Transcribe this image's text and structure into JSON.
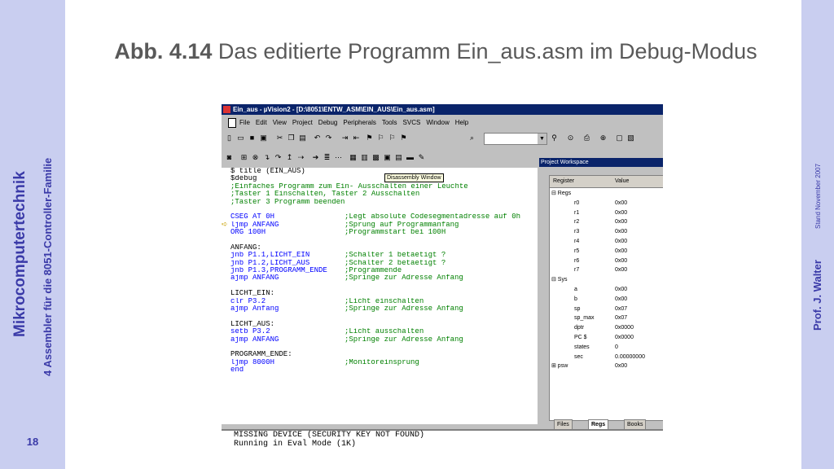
{
  "slide": {
    "title_bold": "Abb. 4.14",
    "title_rest": " Das editierte Programm Ein_aus.asm im Debug-Modus",
    "left_title": "Mikrocomputertechnik",
    "left_subtitle": "4 Assembler für die 8051-Controller-Familie",
    "page_number": "18",
    "right_author": "Prof. J. Walter",
    "right_stand": "Stand  November 2007",
    "accent_color": "#3a3aa8",
    "bar_color": "#c9cef0"
  },
  "window": {
    "title": "Ein_aus  - µVision2 - [D:\\8051\\ENTW_ASM\\EIN_AUS\\Ein_aus.asm]",
    "menu": [
      "File",
      "Edit",
      "View",
      "Project",
      "Debug",
      "Peripherals",
      "Tools",
      "SVCS",
      "Window",
      "Help"
    ],
    "tooltip": "Disassembly Window"
  },
  "code": [
    [
      "t",
      "$ title (EIN_AUS)"
    ],
    [
      "t",
      "$debug"
    ],
    [
      "c",
      ";Einfaches Programm zum Ein- Ausschalten einer Leuchte"
    ],
    [
      "c",
      ";Taster 1 Einschalten, Taster 2 Ausschalten"
    ],
    [
      "c",
      ";Taster 3 Programm beenden"
    ],
    [
      "t",
      ""
    ],
    [
      "k",
      "CSEG AT 0H",
      ";Legt absolute Codesegmentadresse auf 0h"
    ],
    [
      "k",
      "ljmp ANFANG",
      ";Sprung auf Programmanfang"
    ],
    [
      "k",
      "ORG 100H",
      ";Programmstart bei 100H"
    ],
    [
      "t",
      ""
    ],
    [
      "t",
      "ANFANG:"
    ],
    [
      "k",
      "jnb P1.1,LICHT_EIN",
      ";Schalter 1 betaetigt ?"
    ],
    [
      "k",
      "jnb P1.2,LICHT_AUS",
      ";Schalter 2 betaetigt ?"
    ],
    [
      "k",
      "jnb P1.3,PROGRAMM_ENDE",
      ";Programmende"
    ],
    [
      "k",
      "ajmp ANFANG",
      ";Springe zur Adresse Anfang"
    ],
    [
      "t",
      ""
    ],
    [
      "t",
      "LICHT_EIN:"
    ],
    [
      "k",
      "clr P3.2",
      ";Licht einschalten"
    ],
    [
      "k",
      "ajmp Anfang",
      ";Springe zur Adresse Anfang"
    ],
    [
      "t",
      ""
    ],
    [
      "t",
      "LICHT_AUS:"
    ],
    [
      "k",
      "setb P3.2",
      ";Licht ausschalten"
    ],
    [
      "k",
      "ajmp ANFANG",
      ";Springe zur Adresse Anfang"
    ],
    [
      "t",
      ""
    ],
    [
      "t",
      "PROGRAMM_ENDE:"
    ],
    [
      "k",
      "ljmp 8000H",
      ";Monitoreinsprung"
    ],
    [
      "k",
      "end"
    ]
  ],
  "output": [
    "MISSING DEVICE (SECURITY KEY NOT FOUND)",
    "Running in Eval Mode (1K)"
  ],
  "workspace": {
    "title": "Project Workspace",
    "col_register": "Register",
    "col_value": "Value",
    "rows": [
      [
        "⊟ Regs",
        ""
      ],
      [
        "r0",
        "0x00"
      ],
      [
        "r1",
        "0x00"
      ],
      [
        "r2",
        "0x00"
      ],
      [
        "r3",
        "0x00"
      ],
      [
        "r4",
        "0x00"
      ],
      [
        "r5",
        "0x00"
      ],
      [
        "r6",
        "0x00"
      ],
      [
        "r7",
        "0x00"
      ],
      [
        "⊟ Sys",
        ""
      ],
      [
        "a",
        "0x00"
      ],
      [
        "b",
        "0x00"
      ],
      [
        "sp",
        "0x07"
      ],
      [
        "sp_max",
        "0x07"
      ],
      [
        "dptr",
        "0x0000"
      ],
      [
        "PC $",
        "0x0000"
      ],
      [
        "states",
        "0"
      ],
      [
        "sec",
        "0.00000000"
      ],
      [
        "⊞ psw",
        "0x00"
      ]
    ],
    "tabs": [
      "Files",
      "Regs",
      "Books"
    ]
  }
}
